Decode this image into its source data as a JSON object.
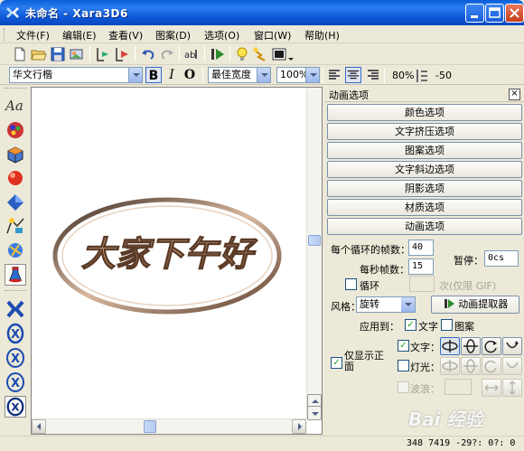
{
  "window": {
    "title": "未命名 - Xara3D6",
    "controls": [
      "minimize",
      "maximize",
      "close"
    ]
  },
  "menu": [
    "文件(F)",
    "编辑(E)",
    "查看(V)",
    "图案(D)",
    "选项(O)",
    "窗口(W)",
    "帮助(H)"
  ],
  "toolbar2": {
    "font": "华文行楷",
    "bold": "B",
    "italic": "I",
    "outline": "O",
    "spacing_mode": "最佳宽度",
    "zoom": "100%",
    "line_spacing": "80%",
    "kerning": "-50"
  },
  "canvas": {
    "text": "大家下午好"
  },
  "panel": {
    "title": "动画选项",
    "option_buttons": [
      "颜色选项",
      "文字挤压选项",
      "图案选项",
      "文字斜边选项",
      "阴影选项",
      "材质选项",
      "动画选项"
    ],
    "frames_per_loop_label": "每个循环的帧数：",
    "frames_per_loop": "40",
    "pause_label": "暂停：",
    "pause_value": "0cs",
    "fps_label": "每秒帧数：",
    "fps": "15",
    "loop_label": "循环",
    "loop_suffix": "次(仅限 GIF)",
    "style_label": "风格：",
    "style_value": "旋转",
    "extractor_button": "动画提取器",
    "apply_to_label": "应用到：",
    "apply_text": "文字",
    "apply_pattern": "图案",
    "front_only": "仅显示正面",
    "text_row": "文字：",
    "light_row": "灯光：",
    "wave_label": "波浪："
  },
  "status": {
    "text": "348 7419 -29?: 0?: 0"
  },
  "watermark": "Bai 经验",
  "colors": {
    "title_bar": "#0a5fd8",
    "workspace": "#ece9d8",
    "text_3d": "#b88a64",
    "ring": "#6b4b36"
  }
}
